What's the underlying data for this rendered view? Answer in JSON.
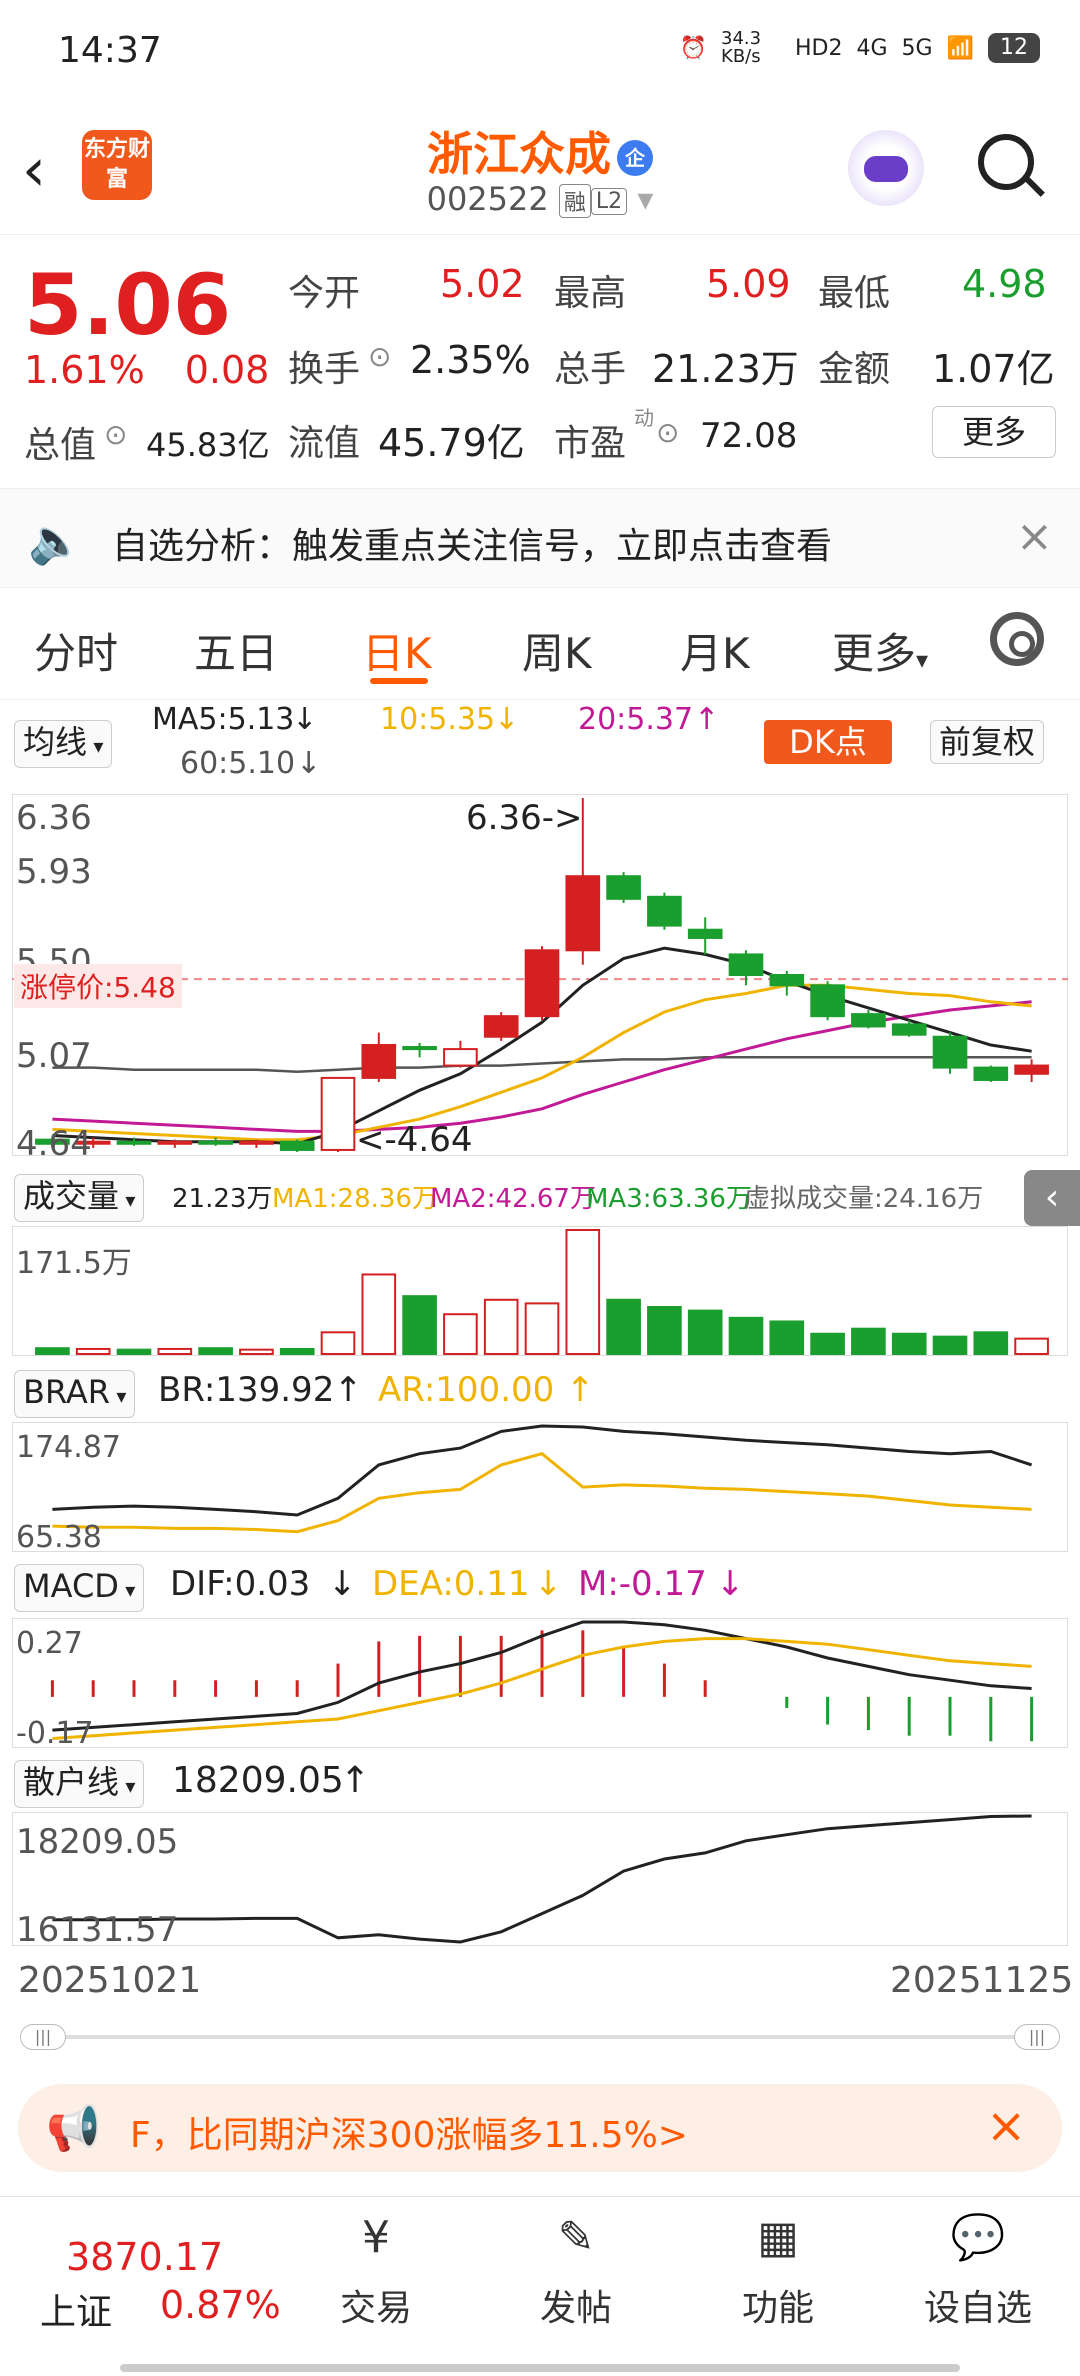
{
  "status_bar": {
    "time": "14:37",
    "net_speed": "34.3 KB/s",
    "hd": "HD2",
    "sig1": "4G",
    "sig2": "5G",
    "battery": "12"
  },
  "header": {
    "logo_text": "东方财富",
    "stock_name": "浙江众成",
    "badge": "企",
    "stock_code": "002522",
    "tag_rong": "融",
    "tag_level": "L2"
  },
  "quote": {
    "price": "5.06",
    "change_pct": "1.61%",
    "change_amt": "0.08",
    "open_label": "今开",
    "open": "5.02",
    "high_label": "最高",
    "high": "5.09",
    "low_label": "最低",
    "low": "4.98",
    "turnover_label": "换手",
    "turnover": "2.35%",
    "volume_label": "总手",
    "volume": "21.23万",
    "amount_label": "金额",
    "amount": "1.07亿",
    "mktcap_label": "总值",
    "mktcap": "45.83亿",
    "float_label": "流值",
    "float": "45.79亿",
    "pe_label": "市盈",
    "pe_sup": "动",
    "pe": "72.08",
    "more": "更多"
  },
  "alert": {
    "text": "自选分析：触发重点关注信号，立即点击查看",
    "close": "×"
  },
  "tabs": {
    "items": [
      "分时",
      "五日",
      "日K",
      "周K",
      "月K",
      "更多"
    ],
    "active": "日K"
  },
  "ma_legend": {
    "selector": "均线",
    "ma5": "MA5:5.13",
    "ma10": "10:5.35",
    "ma20": "20:5.37",
    "ma60": "60:5.10",
    "dk": "DK点",
    "adjust": "前复权"
  },
  "kline": {
    "y_ticks": [
      "6.36",
      "5.93",
      "5.50",
      "5.07",
      "4.64"
    ],
    "limit_up_label": "涨停价:5.48",
    "max_label": "6.36->",
    "min_label": "<-4.64"
  },
  "volume_panel": {
    "selector": "成交量",
    "vol": "21.23万",
    "ma1": "MA1:28.36万",
    "ma2": "MA2:42.67万",
    "ma3": "MA3:63.36万",
    "virtual": "虚拟成交量:24.16万",
    "y_top": "171.5万"
  },
  "brar_panel": {
    "selector": "BRAR",
    "br": "BR:139.92",
    "ar": "AR:100.00",
    "y_top": "174.87",
    "y_bottom": "65.38"
  },
  "macd_panel": {
    "selector": "MACD",
    "dif": "DIF:0.03",
    "dea": "DEA:0.11",
    "m": "M:-0.17",
    "y_top": "0.27",
    "y_bottom": "-0.17"
  },
  "retail_panel": {
    "selector": "散户线",
    "value": "18209.05",
    "y_top": "18209.05",
    "y_bottom": "16131.57"
  },
  "dates": {
    "start": "20251021",
    "end": "20251125"
  },
  "promo": {
    "text": "F，比同期沪深300涨幅多11.5%>",
    "close": "×"
  },
  "bottom_nav": {
    "index_value": "3870.17",
    "index_name": "上证",
    "index_change": "0.87%",
    "items": [
      {
        "label": "交易",
        "icon": "yen-refresh-icon"
      },
      {
        "label": "发帖",
        "icon": "edit-icon"
      },
      {
        "label": "功能",
        "icon": "grid-icon"
      },
      {
        "label": "设自选",
        "icon": "chat-icon"
      }
    ]
  },
  "chart_data": {
    "type": "candlestick",
    "dates": {
      "start": "20251021",
      "end": "20251125"
    },
    "ohlc": [
      {
        "o": 4.7,
        "h": 4.72,
        "l": 4.66,
        "c": 4.68
      },
      {
        "o": 4.69,
        "h": 4.71,
        "l": 4.66,
        "c": 4.69
      },
      {
        "o": 4.69,
        "h": 4.71,
        "l": 4.67,
        "c": 4.68
      },
      {
        "o": 4.68,
        "h": 4.7,
        "l": 4.66,
        "c": 4.69
      },
      {
        "o": 4.69,
        "h": 4.71,
        "l": 4.67,
        "c": 4.68
      },
      {
        "o": 4.68,
        "h": 4.7,
        "l": 4.66,
        "c": 4.69
      },
      {
        "o": 4.69,
        "h": 4.7,
        "l": 4.64,
        "c": 4.65
      },
      {
        "o": 4.65,
        "h": 5.0,
        "l": 4.64,
        "c": 5.0
      },
      {
        "o": 5.0,
        "h": 5.22,
        "l": 4.98,
        "c": 5.16
      },
      {
        "o": 5.15,
        "h": 5.17,
        "l": 5.1,
        "c": 5.14
      },
      {
        "o": 5.06,
        "h": 5.18,
        "l": 5.05,
        "c": 5.14
      },
      {
        "o": 5.2,
        "h": 5.32,
        "l": 5.18,
        "c": 5.3
      },
      {
        "o": 5.3,
        "h": 5.64,
        "l": 5.28,
        "c": 5.62
      },
      {
        "o": 5.62,
        "h": 6.36,
        "l": 5.55,
        "c": 5.98
      },
      {
        "o": 5.98,
        "h": 6.0,
        "l": 5.85,
        "c": 5.87
      },
      {
        "o": 5.88,
        "h": 5.9,
        "l": 5.72,
        "c": 5.74
      },
      {
        "o": 5.72,
        "h": 5.78,
        "l": 5.6,
        "c": 5.68
      },
      {
        "o": 5.6,
        "h": 5.62,
        "l": 5.45,
        "c": 5.5
      },
      {
        "o": 5.5,
        "h": 5.52,
        "l": 5.4,
        "c": 5.45
      },
      {
        "o": 5.45,
        "h": 5.47,
        "l": 5.28,
        "c": 5.3
      },
      {
        "o": 5.31,
        "h": 5.33,
        "l": 5.24,
        "c": 5.25
      },
      {
        "o": 5.26,
        "h": 5.28,
        "l": 5.2,
        "c": 5.21
      },
      {
        "o": 5.2,
        "h": 5.22,
        "l": 5.02,
        "c": 5.05
      },
      {
        "o": 5.05,
        "h": 5.06,
        "l": 4.98,
        "c": 4.99
      },
      {
        "o": 5.02,
        "h": 5.09,
        "l": 4.98,
        "c": 5.06
      }
    ],
    "volume": [
      8,
      7,
      6,
      7,
      8,
      6,
      7,
      30,
      110,
      80,
      55,
      75,
      70,
      171.5,
      75,
      65,
      60,
      50,
      45,
      28,
      35,
      28,
      24,
      30,
      21.23
    ],
    "brar_br": [
      100,
      102,
      103,
      102,
      100,
      98,
      95,
      110,
      140,
      150,
      155,
      170,
      174.87,
      174,
      170,
      168,
      165,
      162,
      160,
      158,
      155,
      152,
      150,
      152,
      139.92
    ],
    "brar_ar": [
      85,
      84,
      84,
      83,
      83,
      82,
      80,
      90,
      110,
      115,
      118,
      140,
      150,
      120,
      122,
      121,
      119,
      118,
      116,
      114,
      112,
      108,
      104,
      102,
      100.0
    ],
    "macd_dif": [
      -0.12,
      -0.11,
      -0.1,
      -0.09,
      -0.08,
      -0.07,
      -0.06,
      -0.02,
      0.05,
      0.09,
      0.12,
      0.16,
      0.22,
      0.27,
      0.27,
      0.26,
      0.24,
      0.21,
      0.18,
      0.14,
      0.11,
      0.08,
      0.06,
      0.04,
      0.03
    ],
    "macd_dea": [
      -0.15,
      -0.14,
      -0.13,
      -0.12,
      -0.11,
      -0.1,
      -0.09,
      -0.08,
      -0.05,
      -0.02,
      0.01,
      0.05,
      0.1,
      0.15,
      0.18,
      0.2,
      0.21,
      0.21,
      0.2,
      0.19,
      0.17,
      0.15,
      0.13,
      0.12,
      0.11
    ],
    "retail": [
      16500,
      16500,
      16500,
      16510,
      16510,
      16520,
      16520,
      16200,
      16250,
      16180,
      16131.57,
      16300,
      16600,
      16900,
      17300,
      17500,
      17600,
      17800,
      17900,
      18000,
      18050,
      18100,
      18150,
      18200,
      18209.05
    ],
    "ma5": [
      4.72,
      4.71,
      4.7,
      4.69,
      4.69,
      4.69,
      4.68,
      4.74,
      4.84,
      4.94,
      5.02,
      5.14,
      5.27,
      5.45,
      5.58,
      5.63,
      5.6,
      5.55,
      5.47,
      5.4,
      5.34,
      5.28,
      5.22,
      5.16,
      5.13
    ],
    "ma10": [
      4.75,
      4.74,
      4.73,
      4.72,
      4.71,
      4.7,
      4.7,
      4.72,
      4.76,
      4.8,
      4.86,
      4.93,
      5.0,
      5.1,
      5.22,
      5.32,
      5.38,
      5.41,
      5.45,
      5.45,
      5.43,
      5.41,
      5.4,
      5.37,
      5.35
    ],
    "ma20": [
      4.8,
      4.79,
      4.78,
      4.77,
      4.76,
      4.75,
      4.74,
      4.74,
      4.75,
      4.76,
      4.78,
      4.81,
      4.85,
      4.92,
      4.98,
      5.04,
      5.09,
      5.14,
      5.19,
      5.23,
      5.27,
      5.3,
      5.33,
      5.35,
      5.37
    ],
    "ma60": [
      5.05,
      5.05,
      5.04,
      5.04,
      5.04,
      5.04,
      5.03,
      5.04,
      5.05,
      5.05,
      5.06,
      5.06,
      5.07,
      5.08,
      5.09,
      5.09,
      5.1,
      5.1,
      5.1,
      5.1,
      5.1,
      5.1,
      5.1,
      5.1,
      5.1
    ],
    "y_range": [
      4.64,
      6.36
    ],
    "limit_up": 5.48
  }
}
